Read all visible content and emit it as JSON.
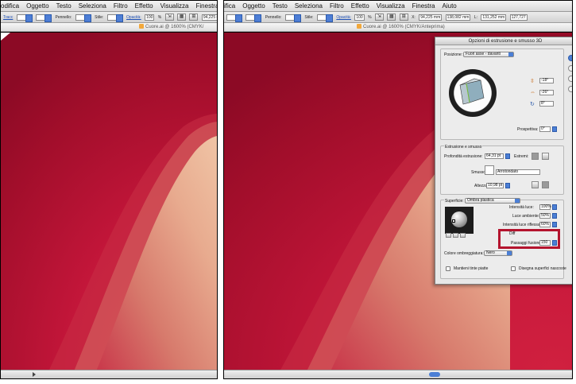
{
  "left_panel": {
    "menu": [
      "odifica",
      "Oggetto",
      "Testo",
      "Seleziona",
      "Filtro",
      "Effetto",
      "Visualizza",
      "Finestra"
    ],
    "control": {
      "fill_label": "Tracc",
      "stroke_label": "Pennello:",
      "style_label": "Stile:",
      "opacity_label": "Opacità:",
      "opacity_value": "100",
      "pct": "%",
      "x_value": "94,225 mm"
    },
    "doc_title": "Cuore.ai @ 1600% (CMYK/"
  },
  "right_panel": {
    "menu": [
      "ifica",
      "Oggetto",
      "Testo",
      "Seleziona",
      "Filtro",
      "Effetto",
      "Visualizza",
      "Finestra",
      "Aiuto"
    ],
    "control": {
      "stroke_label": "Pennello:",
      "style_label": "Stile:",
      "opacity_label": "Opacità:",
      "opacity_value": "100",
      "pct": "%",
      "x_label": "X:",
      "x_value": "94,225 mm",
      "y_value": "138,082 mm",
      "w_label": "L:",
      "w_value": "131,252 mm",
      "h_value": "127,727"
    },
    "doc_title": "Cuore.ai @ 1600% (CMYK/Anteprima)"
  },
  "dialog": {
    "title": "Opzioni di estrusione e smusso 3D",
    "position_label": "Posizione:",
    "position_value": "Fuori asse - davanti",
    "rot_x": "-18°",
    "rot_y": "-26°",
    "rot_z": "8°",
    "perspective_label": "Prospettiva:",
    "perspective_value": "0°",
    "extrusion_group": "Estrusione e smusso",
    "depth_label": "Profondità estrusione:",
    "depth_value": "64,31 pt",
    "caps_label": "Estremi:",
    "bevel_label": "Smusso:",
    "bevel_value": "Arrotondato",
    "height_label": "Altezza:",
    "height_value": "10,98 pt",
    "surface_label": "Superficie:",
    "surface_value": "Ombra plastica",
    "light_intensity_label": "Intensità luce:",
    "light_intensity_value": "100%",
    "ambient_label": "Luce ambiente:",
    "ambient_value": "50%",
    "reflect_label": "Intensità luce riflessa:",
    "reflect_value": "60%",
    "diff_label": "Diff",
    "blend_steps_label": "Passaggi fusione:",
    "blend_steps_value": "150",
    "shading_label": "Colore ombreggiatura:",
    "shading_value": "Nero",
    "preserve_spot": "Mantieni tinte piatte",
    "draw_hidden": "Disegna superfici nascoste",
    "side_texts": [
      "T",
      "L",
      "A",
      "S",
      "R"
    ]
  }
}
